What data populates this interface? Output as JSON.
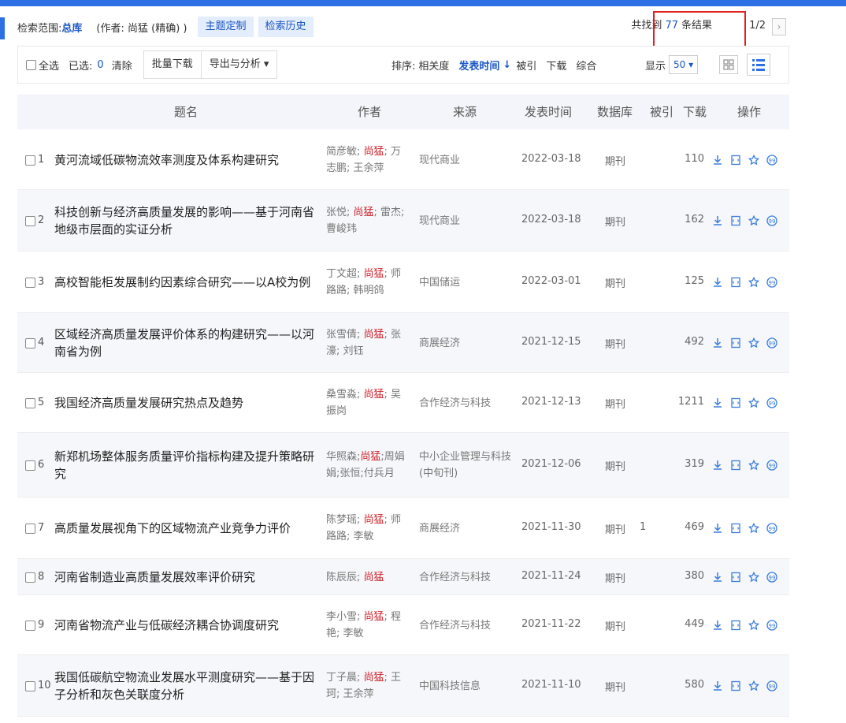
{
  "scope": {
    "label": "检索范围:",
    "value": "总库",
    "author_filter": "(作者: 尚猛 (精确) )",
    "theme_button": "主题定制",
    "history_button": "检索历史"
  },
  "results": {
    "prefix": "共找到",
    "count": "77",
    "suffix": "条结果",
    "page": "1/2",
    "next_glyph": "›"
  },
  "toolbar": {
    "select_all": "全选",
    "selected_label": "已选:",
    "selected_count": "0",
    "clear": "清除",
    "batch_download": "批量下载",
    "export_analysis": "导出与分析 ▾",
    "sort_label": "排序:",
    "sort_relevance": "相关度",
    "sort_date": "发表时间",
    "sort_date_arrow": "↓",
    "sort_cited": "被引",
    "sort_download": "下载",
    "sort_combined": "综合",
    "display_label": "显示",
    "display_value": "50 ▾"
  },
  "table": {
    "headers": {
      "title": "题名",
      "author": "作者",
      "source": "来源",
      "date": "发表时间",
      "database": "数据库",
      "cited": "被引",
      "downloads": "下载",
      "operations": "操作"
    },
    "rows": [
      {
        "idx": "1",
        "title": "黄河流域低碳物流效率测度及体系构建研究",
        "authors_pre": "简彦敏; ",
        "authors_hl": "尚猛",
        "authors_post": "; 万志鹏; 王余萍",
        "source": "现代商业",
        "date": "2022-03-18",
        "db": "期刊",
        "cited": "",
        "downloads": "110"
      },
      {
        "idx": "2",
        "title": "科技创新与经济高质量发展的影响——基于河南省地级市层面的实证分析",
        "authors_pre": "张悦; ",
        "authors_hl": "尚猛",
        "authors_post": "; 雷杰; 曹峻玮",
        "source": "现代商业",
        "date": "2022-03-18",
        "db": "期刊",
        "cited": "",
        "downloads": "162"
      },
      {
        "idx": "3",
        "title": "高校智能柜发展制约因素综合研究——以A校为例",
        "authors_pre": "丁文超; ",
        "authors_hl": "尚猛",
        "authors_post": "; 师路路; 韩明鸽",
        "source": "中国储运",
        "date": "2022-03-01",
        "db": "期刊",
        "cited": "",
        "downloads": "125"
      },
      {
        "idx": "4",
        "title": "区域经济高质量发展评价体系的构建研究——以河南省为例",
        "authors_pre": "张雪倩; ",
        "authors_hl": "尚猛",
        "authors_post": "; 张濠; 刘钰",
        "source": "商展经济",
        "date": "2021-12-15",
        "db": "期刊",
        "cited": "",
        "downloads": "492"
      },
      {
        "idx": "5",
        "title": "我国经济高质量发展研究热点及趋势",
        "authors_pre": "桑雪淼; ",
        "authors_hl": "尚猛",
        "authors_post": "; 吴振岗",
        "source": "合作经济与科技",
        "date": "2021-12-13",
        "db": "期刊",
        "cited": "",
        "downloads": "1211"
      },
      {
        "idx": "6",
        "title": "新郑机场整体服务质量评价指标构建及提升策略研究",
        "authors_pre": "华照森;",
        "authors_hl": "尚猛",
        "authors_post": ";周娟娟;张恒;付兵月",
        "source": "中小企业管理与科技(中旬刊)",
        "date": "2021-12-06",
        "db": "期刊",
        "cited": "",
        "downloads": "319"
      },
      {
        "idx": "7",
        "title": "高质量发展视角下的区域物流产业竞争力评价",
        "authors_pre": "陈梦瑶; ",
        "authors_hl": "尚猛",
        "authors_post": "; 师路路; 李敏",
        "source": "商展经济",
        "date": "2021-11-30",
        "db": "期刊",
        "cited": "1",
        "downloads": "469"
      },
      {
        "idx": "8",
        "title": "河南省制造业高质量发展效率评价研究",
        "authors_pre": "陈辰辰; ",
        "authors_hl": "尚猛",
        "authors_post": "",
        "source": "合作经济与科技",
        "date": "2021-11-24",
        "db": "期刊",
        "cited": "",
        "downloads": "380"
      },
      {
        "idx": "9",
        "title": "河南省物流产业与低碳经济耦合协调度研究",
        "authors_pre": "李小雪; ",
        "authors_hl": "尚猛",
        "authors_post": "; 程艳; 李敏",
        "source": "合作经济与科技",
        "date": "2021-11-22",
        "db": "期刊",
        "cited": "",
        "downloads": "449"
      },
      {
        "idx": "10",
        "title": "我国低碳航空物流业发展水平测度研究——基于因子分析和灰色关联度分析",
        "authors_pre": "丁子晨; ",
        "authors_hl": "尚猛",
        "authors_post": "; 王珂; 王余萍",
        "source": "中国科技信息",
        "date": "2021-11-10",
        "db": "期刊",
        "cited": "",
        "downloads": "580"
      }
    ]
  },
  "icons": [
    "download-icon",
    "html-read-icon",
    "favorite-icon",
    "quote-icon"
  ],
  "colors": {
    "accent": "#1a56c4",
    "highlight_author": "#d0202a",
    "frame": "#e02020"
  }
}
